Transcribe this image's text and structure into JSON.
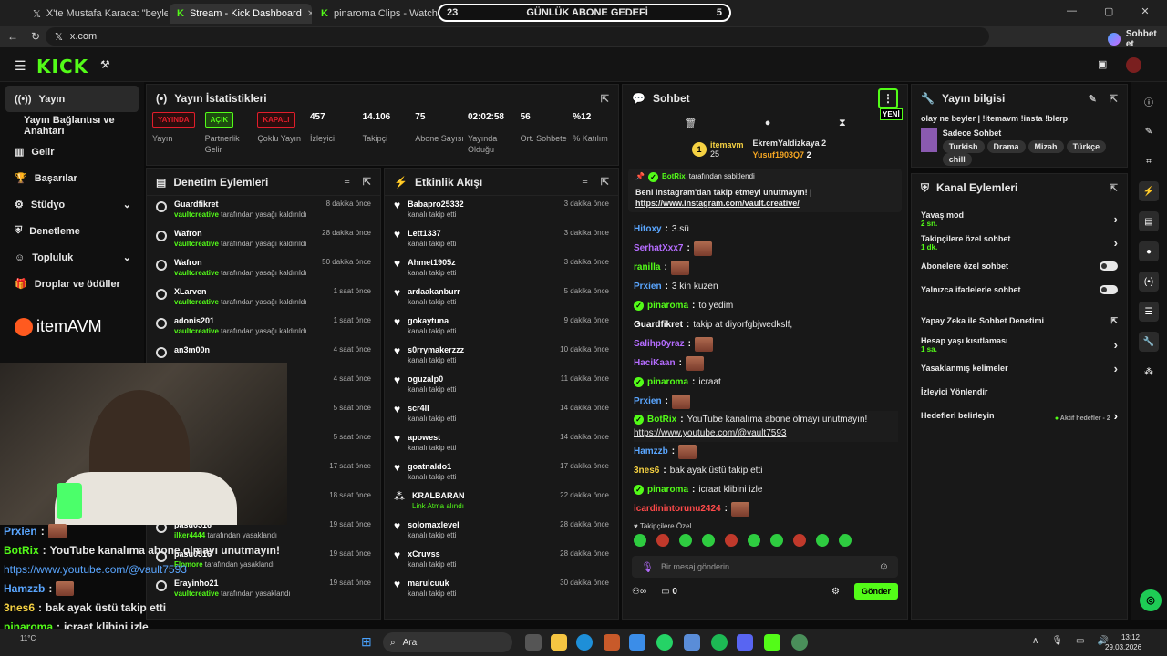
{
  "browser": {
    "tabs": [
      {
        "label": "X'te Mustafa Karaca: \"beyler elimd"
      },
      {
        "label": "Stream - Kick Dashboard"
      },
      {
        "label": "pinaroma Clips - Watch Live on K"
      }
    ],
    "url": "x.com",
    "chat_button": "Sohbet et"
  },
  "goal": {
    "left": "23",
    "title": "GÜNLÜK ABONE GEDEFİ",
    "right": "5"
  },
  "sidebar": {
    "items": [
      {
        "label": "Yayın"
      },
      {
        "label": "Yayın Bağlantısı ve Anahtarı"
      },
      {
        "label": "Gelir"
      },
      {
        "label": "Başarılar"
      },
      {
        "label": "Stüdyo"
      },
      {
        "label": "Denetleme"
      },
      {
        "label": "Topluluk"
      },
      {
        "label": "Droplar ve ödüller"
      }
    ],
    "sponsor": "itemAVM"
  },
  "stats": {
    "title": "Yayın İstatistikleri",
    "items": [
      {
        "badge": "YAYINDA",
        "label": "Yayın",
        "color": "#e11d2b"
      },
      {
        "badge": "AÇIK",
        "label": "Partnerlik Gelir",
        "color": "#53fc18"
      },
      {
        "badge": "KAPALI",
        "label": "Çoklu Yayın",
        "color": "#e11d2b"
      },
      {
        "value": "457",
        "label": "İzleyici"
      },
      {
        "value": "14.106",
        "label": "Takipçi"
      },
      {
        "value": "75",
        "label": "Abone Sayısı"
      },
      {
        "value": "02:02:58",
        "label": "Yayında Olduğu"
      },
      {
        "value": "56",
        "label": "Ort. Sohbete"
      },
      {
        "value": "%12",
        "label": "% Katılım"
      }
    ]
  },
  "moderation": {
    "title": "Denetim Eylemleri",
    "rows": [
      {
        "name": "Guardfikret",
        "by": "vaultcreative",
        "text": "tarafından yasağı kaldırıldı",
        "time": "8 dakika önce"
      },
      {
        "name": "Wafron",
        "by": "vaultcreative",
        "text": "tarafından yasağı kaldırıldı",
        "time": "28 dakika önce"
      },
      {
        "name": "Wafron",
        "by": "vaultcreative",
        "text": "tarafından yasağı kaldırıldı",
        "time": "50 dakika önce"
      },
      {
        "name": "XLarven",
        "by": "vaultcreative",
        "text": "tarafından yasağı kaldırıldı",
        "time": "1 saat önce"
      },
      {
        "name": "adonis201",
        "by": "vaultcreative",
        "text": "tarafından yasağı kaldırıldı",
        "time": "1 saat önce"
      },
      {
        "name": "an3m00n",
        "by": "",
        "text": "",
        "time": "4 saat önce"
      },
      {
        "name": "",
        "by": "",
        "text": "ıldı",
        "time": "4 saat önce"
      },
      {
        "name": "",
        "by": "",
        "text": "",
        "time": "5 saat önce"
      },
      {
        "name": "",
        "by": "",
        "text": "",
        "time": "5 saat önce"
      },
      {
        "name": "",
        "by": "",
        "text": "",
        "time": "17 saat önce"
      },
      {
        "name": "",
        "by": "",
        "text": "",
        "time": "18 saat önce"
      },
      {
        "name": "pasu0516",
        "by": "ilker4444",
        "text": "tarafından yasaklandı",
        "time": "19 saat önce"
      },
      {
        "name": "pasu0516",
        "by": "Flomore",
        "text": "tarafından yasaklandı",
        "time": "19 saat önce"
      },
      {
        "name": "Erayinho21",
        "by": "vaultcreative",
        "text": "tarafından yasaklandı",
        "time": "19 saat önce"
      }
    ]
  },
  "activity": {
    "title": "Etkinlik Akışı",
    "rows": [
      {
        "name": "Babapro25332",
        "text": "kanalı takip etti",
        "time": "3 dakika önce"
      },
      {
        "name": "Lett1337",
        "text": "kanalı takip etti",
        "time": "3 dakika önce"
      },
      {
        "name": "Ahmet1905z",
        "text": "kanalı takip etti",
        "time": "3 dakika önce"
      },
      {
        "name": "ardaakanburr",
        "text": "kanalı takip etti",
        "time": "5 dakika önce"
      },
      {
        "name": "gokaytuna",
        "text": "kanalı takip etti",
        "time": "9 dakika önce"
      },
      {
        "name": "s0rrymakerzzz",
        "text": "kanalı takip etti",
        "time": "10 dakika önce"
      },
      {
        "name": "oguzalp0",
        "text": "kanalı takip etti",
        "time": "11 dakika önce"
      },
      {
        "name": "scr4ll",
        "text": "kanalı takip etti",
        "time": "14 dakika önce"
      },
      {
        "name": "apowest",
        "text": "kanalı takip etti",
        "time": "14 dakika önce"
      },
      {
        "name": "goatnaldo1",
        "text": "kanalı takip etti",
        "time": "17 dakika önce"
      },
      {
        "name": "KRALBARAN",
        "text": "Link Atma alındı",
        "time": "22 dakika önce"
      },
      {
        "name": "solomaxlevel",
        "text": "kanalı takip etti",
        "time": "28 dakika önce"
      },
      {
        "name": "xCruvss",
        "text": "kanalı takip etti",
        "time": "28 dakika önce"
      },
      {
        "name": "marulcuuk",
        "text": "kanalı takip etti",
        "time": "30 dakika önce"
      }
    ]
  },
  "chat": {
    "title": "Sohbet",
    "new_badge": "YENİ",
    "top_gifters": [
      {
        "rank": "1",
        "name": "itemavm",
        "count": "25"
      },
      {
        "name": "EkremYaldizkaya",
        "count": "2"
      },
      {
        "name": "Yusuf1903Q7",
        "count": "2"
      }
    ],
    "pinned": {
      "by": "BotRix",
      "by_text": "tarafından sabitlendi",
      "text": "Beni instagram'dan takip etmeyi unutmayın! |",
      "link": "https://www.instagram.com/vault.creative/"
    },
    "messages": [
      {
        "user": "Hitoxy",
        "color": "#5aa6ff",
        "text": "3.sü"
      },
      {
        "user": "SerhatXxx7",
        "color": "#b56cff",
        "text": "",
        "emote": true
      },
      {
        "user": "ranilla",
        "color": "#53fc18",
        "text": "",
        "emote": true
      },
      {
        "user": "Prxien",
        "color": "#5aa6ff",
        "text": "3 kin kuzen"
      },
      {
        "user": "pinaroma",
        "color": "#53fc18",
        "text": "to yedim",
        "verified": true
      },
      {
        "user": "Guardfikret",
        "color": "#ffffff",
        "text": "takip at diyorfgbjwedkslf,"
      },
      {
        "user": "Salihp0yraz",
        "color": "#b56cff",
        "text": "",
        "emote": true
      },
      {
        "user": "HaciKaan",
        "color": "#b56cff",
        "text": "",
        "emote": true
      },
      {
        "user": "pinaroma",
        "color": "#53fc18",
        "text": "icraat",
        "verified": true
      },
      {
        "user": "Prxien",
        "color": "#5aa6ff",
        "text": "",
        "emote": true
      },
      {
        "user": "BotRix",
        "color": "#53fc18",
        "text": "YouTube kanalıma abone olmayı unutmayın!",
        "link": "https://www.youtube.com/@vault7593",
        "verified": true
      },
      {
        "user": "Hamzzb",
        "color": "#5aa6ff",
        "text": "",
        "emote": true
      },
      {
        "user": "3nes6",
        "color": "#f5d142",
        "text": "bak ayak üstü takip etti"
      },
      {
        "user": "pinaroma",
        "color": "#53fc18",
        "text": "icraat klibini izle",
        "verified": true
      },
      {
        "user": "icardinintorunu2424",
        "color": "#ff4a4a",
        "text": "",
        "emote": true
      }
    ],
    "emote_label": "Takipçilere Özel",
    "input_placeholder": "Bir mesaj gönderin",
    "count": "0",
    "send_label": "Gönder"
  },
  "stream_info": {
    "title": "Yayın bilgisi",
    "stream_title": "olay ne beyler | !itemavm !insta !blerp",
    "category": "Sadece Sohbet",
    "tags": [
      "Turkish",
      "Drama",
      "Mizah",
      "Türkçe",
      "chill"
    ]
  },
  "channel_actions": {
    "title": "Kanal Eylemleri",
    "items": [
      {
        "label": "Yavaş mod",
        "sub": "2 sn.",
        "type": "arrow"
      },
      {
        "label": "Takipçilere özel sohbet",
        "sub": "1 dk.",
        "type": "arrow"
      },
      {
        "label": "Abonelere özel sohbet",
        "sub": "",
        "type": "toggle"
      },
      {
        "label": "Yalnızca ifadelerle sohbet",
        "sub": "",
        "type": "toggle"
      },
      {
        "label": "Yapay Zeka ile Sohbet Denetimi",
        "sub": "",
        "type": "ext"
      },
      {
        "label": "Hesap yaşı kısıtlaması",
        "sub": "1 sa.",
        "type": "arrow"
      },
      {
        "label": "Yasaklanmış kelimeler",
        "sub": "",
        "type": "arrow"
      },
      {
        "label": "İzleyici Yönlendir",
        "sub": "",
        "type": "none"
      },
      {
        "label": "Hedefleri belirleyin",
        "sub": "",
        "type": "goals",
        "extra": "Aktif hedefler - 2"
      }
    ]
  },
  "overlay_chat": [
    {
      "user": "Prxien",
      "color": "#5aa6ff",
      "text": "",
      "emote": true
    },
    {
      "user": "BotRix",
      "color": "#53fc18",
      "text": "YouTube kanalıma abone olmayı unutmayın!"
    },
    {
      "user": "",
      "color": "#5aa6ff",
      "text": "https://www.youtube.com/@vault7593"
    },
    {
      "user": "Hamzzb",
      "color": "#5aa6ff",
      "text": "",
      "emote": true
    },
    {
      "user": "3nes6",
      "color": "#f5d142",
      "text": "bak ayak üstü takip etti"
    },
    {
      "user": "pinaroma",
      "color": "#53fc18",
      "text": "icraat klibini izle"
    },
    {
      "user": "icardinintorunu2424",
      "color": "#ff4a4a",
      "text": "",
      "emote": true
    }
  ],
  "taskbar": {
    "weather": "11°C",
    "search": "Ara",
    "time": "13:12",
    "date": "29.03.2026"
  }
}
